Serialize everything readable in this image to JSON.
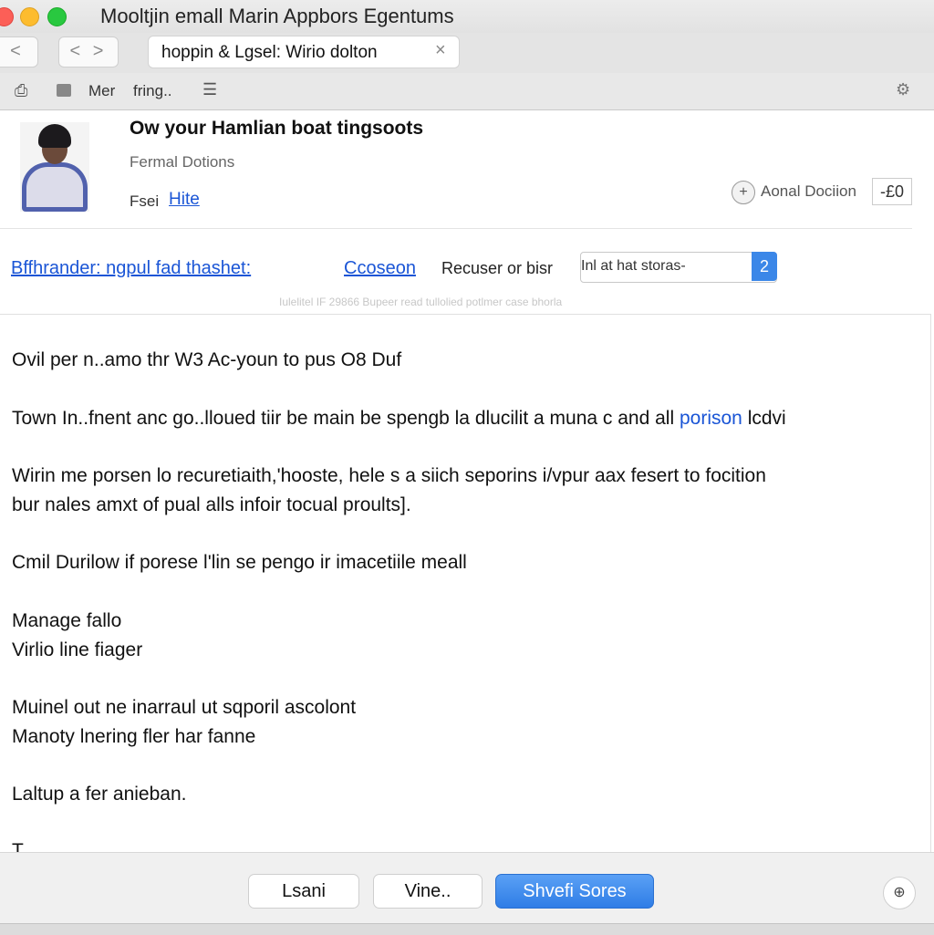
{
  "window": {
    "title": "Mooltjin emall Marin Appbors Egentums",
    "tab_label": "hoppin & Lgsel: Wirio dolton",
    "back_glyph": "<",
    "forward_glyph": "< >",
    "close_glyph": "×"
  },
  "toolbar": {
    "item1": "Mer",
    "item2": "fring..",
    "menu_glyph": "☰"
  },
  "message": {
    "subject": "Ow your Hamlian boat tingsoots",
    "meta_line": "Fermal Dotions",
    "from_label": "Fsei",
    "from_link": "Hite",
    "aside_icon": "+",
    "aside_label": "Aonal Dociion",
    "aside_value": "-£0"
  },
  "actions": {
    "left_link": "Bffhrander: ngpul fad thashet:",
    "mid_link": "Ccoseon",
    "right_label": "Recuser or bisr",
    "select_value": "Inl at hat storas-",
    "select_button": "2",
    "faint_text": "Iulelitel IF 29866 Bupeer read tullolied potlmer case bhorla"
  },
  "body": {
    "line1": "Ovil per n..amo thr W3 Ac-youn to pus O8 Duf",
    "line2_pre": "Town In..fnent anc go..lloued tiir be main be spengb la dlucilit a muna c and all",
    "line2_link": "porison",
    "line2_post": "lcdvi",
    "line3a": "Wirin me porsen lo recuretiaith,'hooste, hele s a siich seporins i/vpur aax fesert to focition",
    "line3b": "bur nales amxt of pual alls infoir tocual proults].",
    "line4": "Cmil Durilow if porese l'lin se pengo ir imacetiile meall",
    "line5a": "Manage fallo",
    "line5b": "Virlio line fiager",
    "line6a": "Muinel out ne inarraul ut sqporil ascolont",
    "line6b": "Manoty lnering fler har fanne",
    "line7": "Laltup a fer anieban.",
    "line8": "T..."
  },
  "footer": {
    "button1": "Lsani",
    "button2": "Vine..",
    "primary_button": "Shvefi Sores",
    "circle_glyph": "⊕"
  }
}
